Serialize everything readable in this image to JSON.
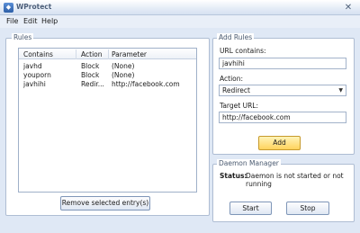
{
  "window": {
    "title": "WProtect"
  },
  "menu": [
    "File",
    "Edit",
    "Help"
  ],
  "rules": {
    "label": "Rules",
    "columns": [
      "Contains",
      "Action",
      "Parameter"
    ],
    "rows": [
      [
        "javhd",
        "Block",
        "(None)"
      ],
      [
        "youporn",
        "Block",
        "(None)"
      ],
      [
        "javhihi",
        "Redir...",
        "http://facebook.com"
      ]
    ],
    "remove_label": "Remove selected entry(s)"
  },
  "add_rules": {
    "label": "Add Rules",
    "url_label": "URL contains:",
    "url_value": "javhihi",
    "action_label": "Action:",
    "action_value": "Redirect",
    "target_label": "Target URL:",
    "target_value": "http://facebook.com",
    "add_label": "Add"
  },
  "daemon": {
    "label": "Daemon Manager",
    "status_label": "Status:",
    "status_value": "Daemon is not started or not running",
    "start_label": "Start",
    "stop_label": "Stop"
  }
}
